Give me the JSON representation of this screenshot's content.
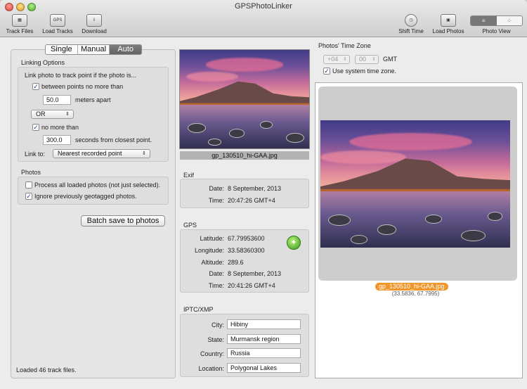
{
  "window": {
    "title": "GPSPhotoLinker"
  },
  "toolbar": {
    "track_files": "Track Files",
    "load_tracks": "Load Tracks",
    "download": "Download",
    "shift_time": "Shift Time",
    "load_photos": "Load Photos",
    "photo_view": "Photo View",
    "gps_icon_text": "GPS"
  },
  "mode_tabs": [
    "Single",
    "Manual",
    "Auto"
  ],
  "linking": {
    "title": "Linking Options",
    "intro": "Link photo to track point if the photo is...",
    "between_label": "between points no more than",
    "between_checked": true,
    "meters_value": "50.0",
    "meters_label": "meters apart",
    "operator": "OR",
    "no_more_label": "no more than",
    "no_more_checked": true,
    "seconds_value": "300.0",
    "seconds_label": "seconds from closest point.",
    "link_to_label": "Link to:",
    "link_to_value": "Nearest recorded point"
  },
  "photos_group": {
    "title": "Photos",
    "process_all": "Process all loaded photos (not just selected).",
    "process_all_checked": false,
    "ignore_geotagged": "Ignore previously geotagged photos.",
    "ignore_geotagged_checked": true
  },
  "batch_button": "Batch save to photos",
  "status": "Loaded 46 track files.",
  "thumbnail": {
    "filename": "gp_130510_hi-GAA.jpg"
  },
  "exif": {
    "title": "Exif",
    "date_label": "Date:",
    "date": "8 September, 2013",
    "time_label": "Time:",
    "time": "20:47:26 GMT+4"
  },
  "gps": {
    "title": "GPS",
    "latitude_label": "Latitude:",
    "latitude": "67.79953600",
    "longitude_label": "Longitude:",
    "longitude": "33.58360300",
    "altitude_label": "Altitude:",
    "altitude": "289.6",
    "date_label": "Date:",
    "date": "8 September, 2013",
    "time_label": "Time:",
    "time": "20:41:26 GMT+4"
  },
  "iptc": {
    "title": "IPTC/XMP",
    "city_label": "City:",
    "city": "Hibiny",
    "state_label": "State:",
    "state": "Murmansk region",
    "country_label": "Country:",
    "country": "Russia",
    "location_label": "Location:",
    "location": "Polygonal Lakes"
  },
  "timezone": {
    "title": "Photos' Time Zone",
    "hours": "+04",
    "minutes": "00",
    "gmt": "GMT",
    "use_system": "Use system time zone.",
    "use_system_checked": true
  },
  "selected_photo": {
    "filename": "gp_130510_hi-GAA.jpg",
    "coords": "(33.5836, 67.7995)"
  },
  "colors": {
    "selection": "#f0962a",
    "segment_active": "#6e6e6e"
  }
}
